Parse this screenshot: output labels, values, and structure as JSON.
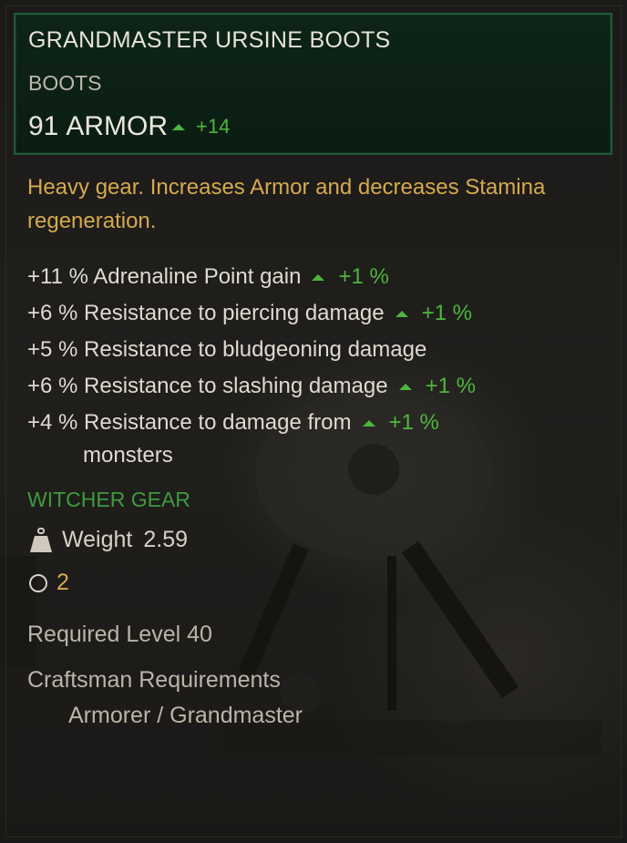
{
  "item": {
    "name": "GRANDMASTER URSINE BOOTS",
    "type": "BOOTS",
    "armor_value": "91",
    "armor_label": "ARMOR",
    "armor_bonus": "+14",
    "description": "Heavy gear. Increases Armor and decreases Stamina regeneration."
  },
  "stats": [
    {
      "text": "+11 % Adrenaline Point gain",
      "bonus": "+1 %"
    },
    {
      "text": "+6 % Resistance to piercing damage",
      "bonus": "+1 %"
    },
    {
      "text": "+5 % Resistance to bludgeoning damage",
      "bonus": ""
    },
    {
      "text": "+6 % Resistance to slashing damage",
      "bonus": "+1 %"
    },
    {
      "text": "+4 % Resistance to damage from",
      "bonus": "+1 %",
      "continuation": "monsters"
    }
  ],
  "set_label": "WITCHER GEAR",
  "weight": {
    "label": "Weight",
    "value": "2.59",
    "icon": "weight-icon"
  },
  "slots": {
    "value": "2",
    "icon": "slot-circle-icon"
  },
  "required_level": "Required Level 40",
  "craftsman": {
    "title": "Craftsman Requirements",
    "value": "Armorer / Grandmaster"
  },
  "colors": {
    "header_border": "#1f5a37",
    "header_bg": "#0e2418",
    "description": "#d6a94e",
    "bonus_green": "#4fb53e",
    "set_green": "#3f9a3c",
    "text": "#dedbd1"
  }
}
